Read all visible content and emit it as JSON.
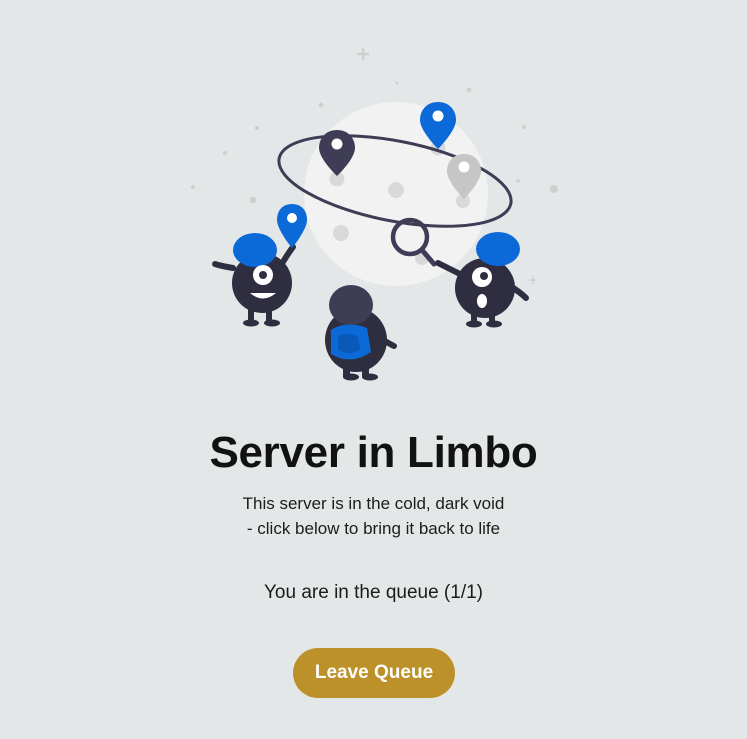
{
  "limbo": {
    "title": "Server in Limbo",
    "subtitle_line1": "This server is in the cold, dark void",
    "subtitle_line2": "- click below to bring it back to life",
    "queue_status": "You are in the queue (1/1)",
    "leave_button_label": "Leave Queue"
  },
  "colors": {
    "background": "#e4e7e8",
    "button": "#bd9129",
    "accent_blue": "#0b6ad8",
    "character_dark": "#2f2e41"
  },
  "icons": [
    "moon-planet-icon",
    "map-pin-icon",
    "magnifier-icon",
    "character-icon"
  ]
}
